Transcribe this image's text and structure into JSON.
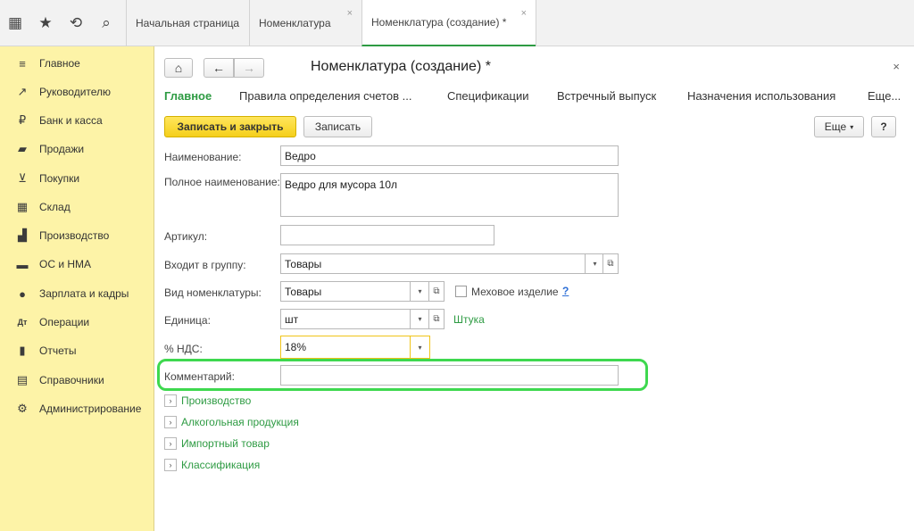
{
  "top_icons": [
    {
      "name": "apps-grid-icon",
      "glyph": "▦"
    },
    {
      "name": "star-icon",
      "glyph": "★"
    },
    {
      "name": "history-icon",
      "glyph": "⟲"
    },
    {
      "name": "search-icon",
      "glyph": "⌕"
    }
  ],
  "tabs": [
    {
      "label": "Начальная страница",
      "closable": false
    },
    {
      "label": "Номенклатура",
      "closable": true
    },
    {
      "label": "Номенклатура (создание) *",
      "closable": true
    }
  ],
  "sidebar": {
    "items": [
      {
        "label": "Главное",
        "icon": "menu-icon",
        "glyph": "≡"
      },
      {
        "label": "Руководителю",
        "icon": "trend-icon",
        "glyph": "↗"
      },
      {
        "label": "Банк и касса",
        "icon": "coin-icon",
        "glyph": "₽"
      },
      {
        "label": "Продажи",
        "icon": "bag-icon",
        "glyph": "▰"
      },
      {
        "label": "Покупки",
        "icon": "cart-icon",
        "glyph": "⊻"
      },
      {
        "label": "Склад",
        "icon": "warehouse-icon",
        "glyph": "▦"
      },
      {
        "label": "Производство",
        "icon": "factory-icon",
        "glyph": "▟"
      },
      {
        "label": "ОС и НМА",
        "icon": "truck-icon",
        "glyph": "▬"
      },
      {
        "label": "Зарплата и кадры",
        "icon": "person-icon",
        "glyph": "●"
      },
      {
        "label": "Операции",
        "icon": "dt-kt-icon",
        "glyph": "Дт"
      },
      {
        "label": "Отчеты",
        "icon": "bar-chart-icon",
        "glyph": "▮"
      },
      {
        "label": "Справочники",
        "icon": "book-icon",
        "glyph": "▤"
      },
      {
        "label": "Администрирование",
        "icon": "gear-icon",
        "glyph": "⚙"
      }
    ]
  },
  "form": {
    "title": "Номенклатура (создание) *",
    "close_glyph": "×",
    "home_glyph": "⌂",
    "back_glyph": "←",
    "forward_glyph": "→",
    "nav_tabs": [
      "Главное",
      "Правила определения счетов ...",
      "Спецификации",
      "Встречный выпуск",
      "Назначения использования",
      "Еще..."
    ],
    "save_close_label": "Записать и закрыть",
    "save_label": "Записать",
    "more_label": "Еще",
    "more_glyph": "▾",
    "help_label": "?"
  },
  "fields": {
    "name": {
      "label": "Наименование:",
      "value": "Ведро"
    },
    "full_name": {
      "label": "Полное наименование:",
      "value": "Ведро для мусора 10л"
    },
    "article": {
      "label": "Артикул:",
      "value": ""
    },
    "group": {
      "label": "Входит в группу:",
      "value": "Товары"
    },
    "kind": {
      "label": "Вид номенклатуры:",
      "value": "Товары"
    },
    "fur": {
      "label": "Меховое изделие",
      "help": "?"
    },
    "unit": {
      "label": "Единица:",
      "value": "шт",
      "hint": "Штука"
    },
    "vat": {
      "label": "% НДС:",
      "value": "18%"
    },
    "comment": {
      "label": "Комментарий:",
      "value": ""
    }
  },
  "sections": [
    "Производство",
    "Алкогольная продукция",
    "Импортный товар",
    "Классификация"
  ],
  "colors": {
    "accent_green": "#2e9b43",
    "sidebar_bg": "#fdf3a7",
    "primary_button": "#f5cf1b",
    "highlight": "#3ed84f"
  }
}
